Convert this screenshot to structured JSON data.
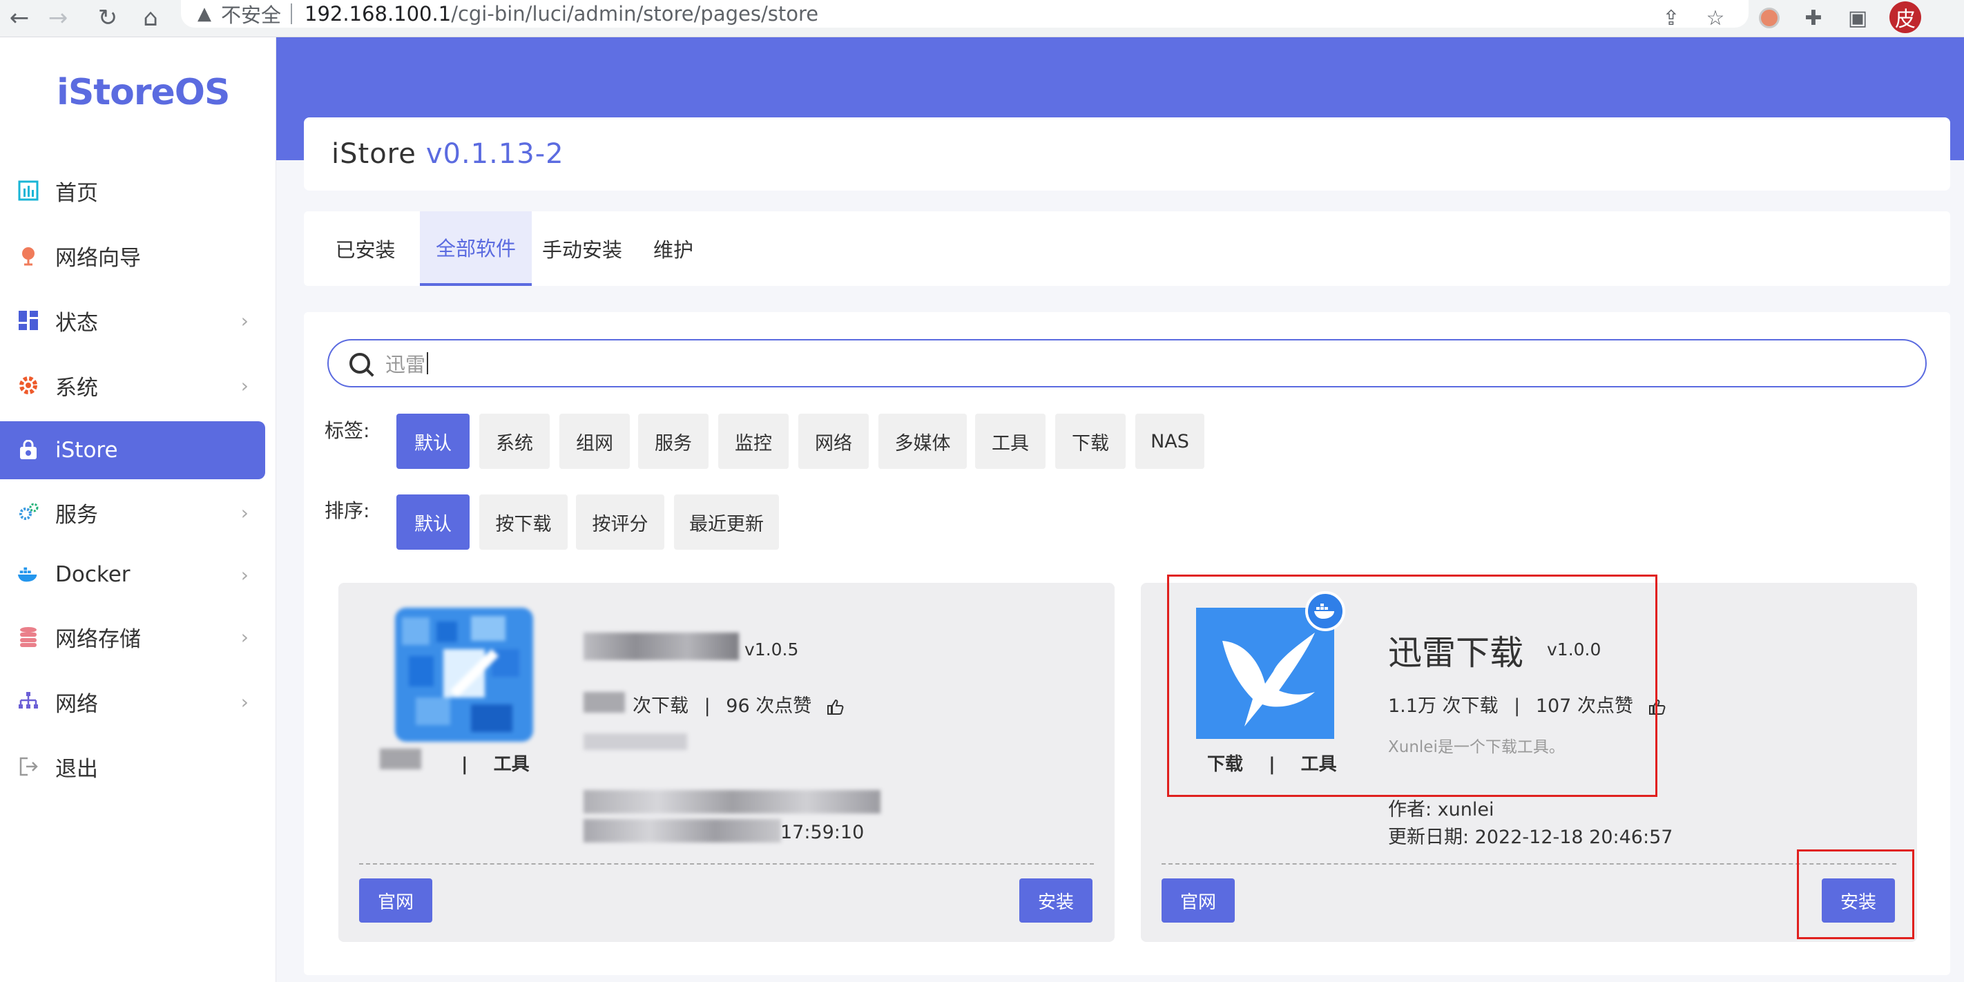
{
  "browser": {
    "url_warning": "不安全",
    "url_host": "192.168.100.1",
    "url_path": "/cgi-bin/luci/admin/store/pages/store",
    "profile_initial": "皮"
  },
  "sidebar": {
    "logo": "iStoreOS",
    "items": [
      {
        "label": "首页",
        "icon": "home-chart-icon",
        "chevron": false
      },
      {
        "label": "网络向导",
        "icon": "globe-wizard-icon",
        "chevron": false
      },
      {
        "label": "状态",
        "icon": "dashboard-icon",
        "chevron": true
      },
      {
        "label": "系统",
        "icon": "gear-icon",
        "chevron": true
      },
      {
        "label": "iStore",
        "icon": "store-bag-icon",
        "chevron": false,
        "active": true
      },
      {
        "label": "服务",
        "icon": "services-gears-icon",
        "chevron": true
      },
      {
        "label": "Docker",
        "icon": "docker-whale-icon",
        "chevron": true
      },
      {
        "label": "网络存储",
        "icon": "storage-db-icon",
        "chevron": true
      },
      {
        "label": "网络",
        "icon": "network-tree-icon",
        "chevron": true
      },
      {
        "label": "退出",
        "icon": "logout-icon",
        "chevron": false
      }
    ]
  },
  "header": {
    "title": "iStore",
    "version": "v0.1.13-2"
  },
  "tabs": [
    {
      "label": "已安装"
    },
    {
      "label": "全部软件",
      "active": true
    },
    {
      "label": "手动安装"
    },
    {
      "label": "维护"
    }
  ],
  "search": {
    "value": "迅雷"
  },
  "filters": {
    "tags_label": "标签:",
    "tags": [
      "默认",
      "系统",
      "组网",
      "服务",
      "监控",
      "网络",
      "多媒体",
      "工具",
      "下载",
      "NAS"
    ],
    "sort_label": "排序:",
    "sorts": [
      "默认",
      "按下载",
      "按评分",
      "最近更新"
    ]
  },
  "apps": [
    {
      "name": "",
      "version": "v1.0.5",
      "downloads_text": "次下载",
      "likes_text": "96 次点赞",
      "tags_sep": "|",
      "tag2": "工具",
      "time_fragment": "17:59:10",
      "official_label": "官网",
      "install_label": "安装",
      "obscured": true
    },
    {
      "name": "迅雷下载",
      "version": "v1.0.0",
      "downloads_text": "1.1万 次下载",
      "likes_text": "107 次点赞",
      "description": "Xunlei是一个下载工具。",
      "tag1": "下载",
      "tags_sep": "|",
      "tag2": "工具",
      "author": "作者: xunlei",
      "updated": "更新日期: 2022-12-18 20:46:57",
      "official_label": "官网",
      "install_label": "安装"
    }
  ],
  "colors": {
    "accent": "#5b6be0",
    "band": "#5f6fe3",
    "highlight_box": "#e0201e"
  }
}
